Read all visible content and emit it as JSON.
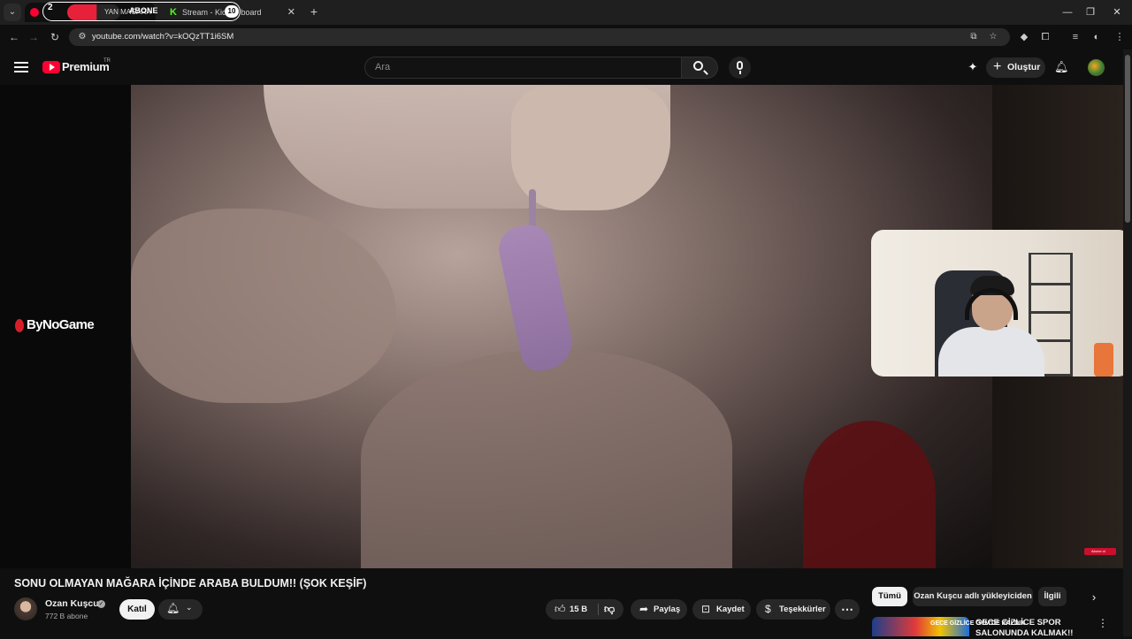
{
  "browser": {
    "tabs": [
      {
        "label": "YAN MAĞARA",
        "active": true,
        "favicon": "youtube-favicon"
      },
      {
        "label": "Stream - Kick",
        "suffix": "board",
        "active": false,
        "favicon": "kick-favicon"
      }
    ],
    "overlay": {
      "count": "2",
      "abone": "ABONE",
      "badge": "10"
    },
    "url": "youtube.com/watch?v=kOQzTT1i6SM"
  },
  "youtube": {
    "logo_text": "Premium",
    "region": "TR",
    "search_placeholder": "Ara",
    "create_label": "Oluştur"
  },
  "video": {
    "brand_watermark": "ByNoGame",
    "corner_badge": "Abone ol",
    "title": "SONU OLMAYAN MAĞARA İÇİNDE ARABA BULDUM!! (ŞOK KEŞİF)"
  },
  "channel": {
    "name": "Ozan Kuşcu",
    "subscribers": "772 B abone",
    "join_label": "Katıl",
    "verified_icon": "check-circle-icon"
  },
  "actions": {
    "likes": "15 B",
    "share": "Paylaş",
    "save": "Kaydet",
    "thanks": "Teşekkürler",
    "more": "⋯"
  },
  "chips": [
    "Tümü",
    "Ozan Kuşcu adlı yükleyiciden",
    "İlgili"
  ],
  "recommendation": {
    "thumb_text": "GECE GİZLİCE GYM'DE KALDIK",
    "title": "GECE GİZLİCE SPOR SALONUNDA KALMAK!!"
  },
  "colors": {
    "accent_red": "#ff0033",
    "background": "#0f0f0f",
    "chip_bg": "#272727"
  }
}
